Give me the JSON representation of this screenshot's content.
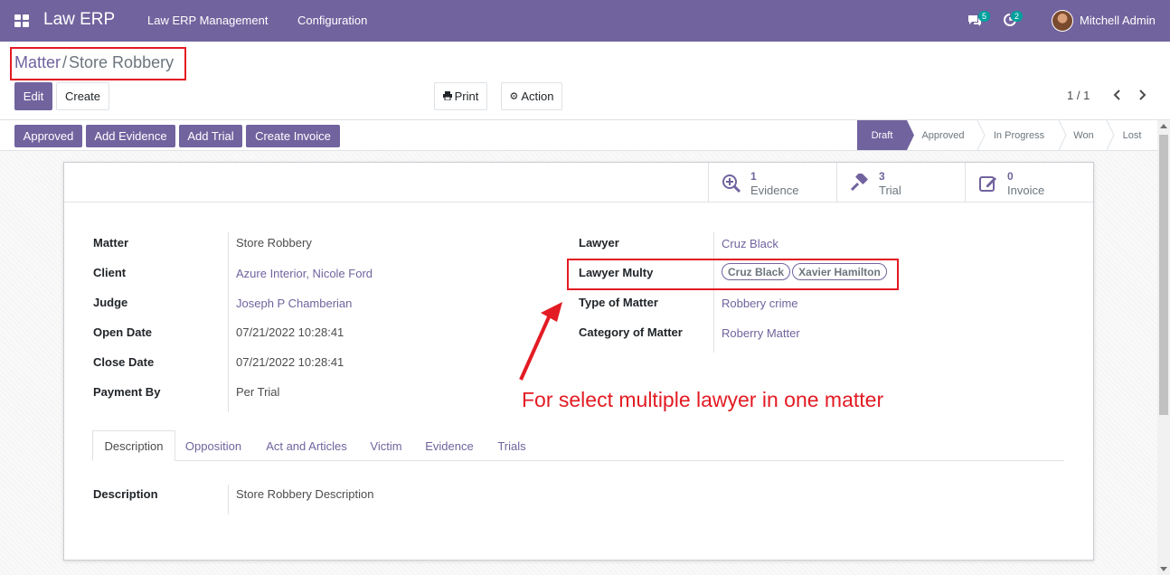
{
  "navbar": {
    "brand": "Law ERP",
    "menu": [
      "Law ERP Management",
      "Configuration"
    ],
    "messages_count": "5",
    "activities_count": "2",
    "user_name": "Mitchell Admin",
    "accent": "#71639e"
  },
  "breadcrumb": {
    "parent": "Matter",
    "separator": "/",
    "current": "Store Robbery"
  },
  "toolbar": {
    "edit": "Edit",
    "create": "Create",
    "print": "Print",
    "action": "Action",
    "pager": "1 / 1"
  },
  "statusbar": {
    "buttons": [
      "Approved",
      "Add Evidence",
      "Add Trial",
      "Create Invoice"
    ],
    "stages": [
      "Draft",
      "Approved",
      "In Progress",
      "Won",
      "Lost"
    ],
    "active_stage": "Draft"
  },
  "smart_buttons": [
    {
      "count": "1",
      "label": "Evidence",
      "icon": "search-plus-icon"
    },
    {
      "count": "3",
      "label": "Trial",
      "icon": "gavel-icon"
    },
    {
      "count": "0",
      "label": "Invoice",
      "icon": "edit-icon"
    }
  ],
  "left_fields": [
    {
      "label": "Matter",
      "value": "Store Robbery"
    },
    {
      "label": "Client",
      "value": "Azure Interior, Nicole Ford"
    },
    {
      "label": "Judge",
      "value": "Joseph P Chamberian"
    },
    {
      "label": "Open Date",
      "value": "07/21/2022 10:28:41"
    },
    {
      "label": "Close Date",
      "value": "07/21/2022 10:28:41"
    },
    {
      "label": "Payment By",
      "value": "Per Trial"
    }
  ],
  "right_fields": {
    "lawyer_label": "Lawyer",
    "lawyer_value": "Cruz Black",
    "lawyer_multy_label": "Lawyer Multy",
    "lawyer_multy_tags": [
      "Cruz Black",
      "Xavier Hamilton"
    ],
    "type_label": "Type of Matter",
    "type_value": "Robbery crime",
    "category_label": "Category of Matter",
    "category_value": "Roberry Matter"
  },
  "tabs": [
    "Description",
    "Opposition",
    "Act and Articles",
    "Victim",
    "Evidence",
    "Trials"
  ],
  "description": {
    "label": "Description",
    "value": "Store Robbery Description"
  },
  "annotation": {
    "text": "For select multiple lawyer in one matter",
    "color": "#e31b23"
  }
}
